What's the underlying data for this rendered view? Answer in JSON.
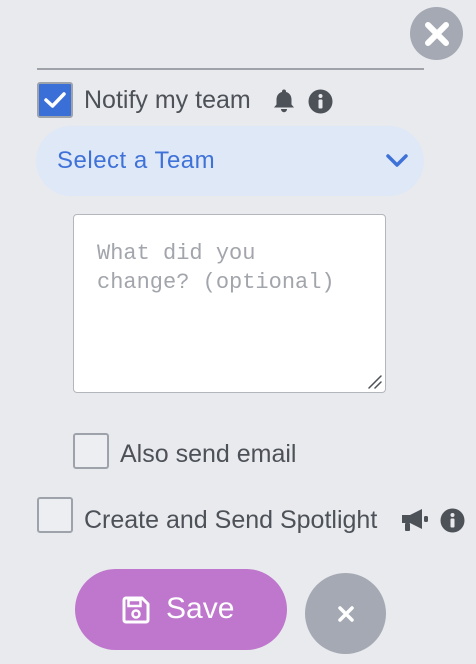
{
  "notify": {
    "label": "Notify my team",
    "checked": true,
    "icons": [
      "bell-icon",
      "info-icon"
    ]
  },
  "team_select": {
    "value": "Select a Team",
    "icon": "chevron-down-icon"
  },
  "message": {
    "placeholder": "What did you change? (optional)",
    "value": ""
  },
  "email": {
    "label": "Also send email",
    "checked": false
  },
  "spotlight": {
    "label": "Create and Send Spotlight",
    "checked": false,
    "icons": [
      "megaphone-icon",
      "info-icon"
    ]
  },
  "actions": {
    "save_label": "Save",
    "save_icon": "save-icon",
    "cancel_icon": "close-icon",
    "top_close_icon": "close-circle-icon"
  },
  "colors": {
    "background": "#e9eaee",
    "accent_blue": "#3a6fd8",
    "select_bg": "#dfe8f6",
    "save_bg": "#be77cd",
    "close_bg": "#a4a9b3"
  }
}
